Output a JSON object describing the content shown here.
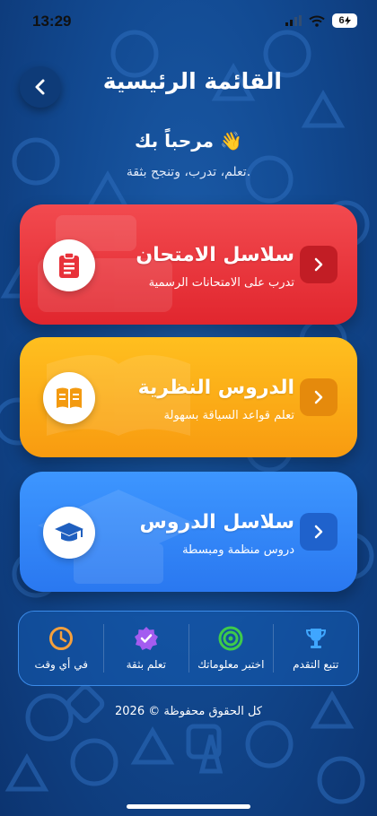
{
  "status_bar": {
    "time": "13:29",
    "battery": "6"
  },
  "header": {
    "title": "القائمة الرئيسية"
  },
  "welcome": {
    "greeting": "مرحباً بك 👋",
    "subtitle": "تعلم، تدرب، وتنجح بثقة."
  },
  "cards": [
    {
      "title": "سلاسل الامتحان",
      "subtitle": "تدرب على الامتحانات الرسمية",
      "icon": "clipboard-icon",
      "color": "#e8323a"
    },
    {
      "title": "الدروس النظرية",
      "subtitle": "تعلم قواعد السياقة بسهولة",
      "icon": "book-icon",
      "color": "#fcaa16"
    },
    {
      "title": "سلاسل الدروس",
      "subtitle": "دروس منظمة ومبسطة",
      "icon": "graduation-cap-icon",
      "color": "#3287f7"
    }
  ],
  "features": [
    {
      "label": "تتبع التقدم",
      "icon": "trophy-icon",
      "color": "#3fa6ff"
    },
    {
      "label": "اختبر معلوماتك",
      "icon": "target-icon",
      "color": "#3ecb4a"
    },
    {
      "label": "تعلم بثقة",
      "icon": "verified-badge-icon",
      "color": "#a35cf0"
    },
    {
      "label": "في أي وقت",
      "icon": "clock-icon",
      "color": "#f5a03c"
    }
  ],
  "footer": {
    "text": "2026 © كل الحقوق محفوظة"
  }
}
